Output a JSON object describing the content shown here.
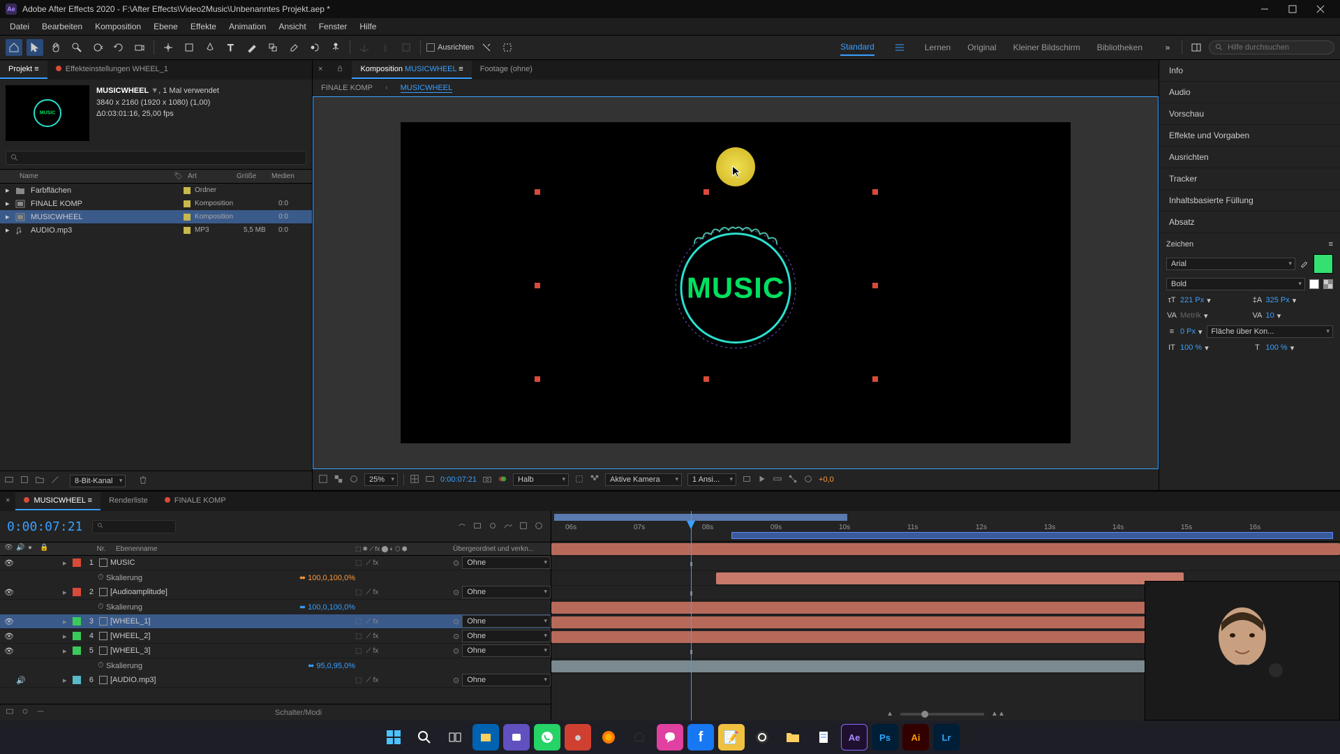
{
  "titlebar": {
    "title": "Adobe After Effects 2020 - F:\\After Effects\\Video2Music\\Unbenanntes Projekt.aep *"
  },
  "menus": [
    "Datei",
    "Bearbeiten",
    "Komposition",
    "Ebene",
    "Effekte",
    "Animation",
    "Ansicht",
    "Fenster",
    "Hilfe"
  ],
  "toolbar": {
    "align": "Ausrichten"
  },
  "workspaces": {
    "items": [
      "Standard",
      "Lernen",
      "Original",
      "Kleiner Bildschirm",
      "Bibliotheken"
    ],
    "activeIndex": 0
  },
  "search": {
    "placeholder": "Hilfe durchsuchen"
  },
  "projectPanel": {
    "tab1": "Projekt",
    "tab2": "Effekteinstellungen  WHEEL_1",
    "compName": "MUSICWHEEL",
    "used": ", 1 Mal verwendet",
    "dims": "3840 x 2160 (1920 x 1080) (1,00)",
    "dur": "Δ0:03:01:16, 25,00 fps",
    "cols": {
      "name": "Name",
      "type": "Art",
      "size": "Größe",
      "media": "Medien"
    },
    "rows": [
      {
        "name": "Farbflächen",
        "type": "Ordner",
        "size": "",
        "media": "",
        "kind": "folder",
        "label": "#c9b84a"
      },
      {
        "name": "FINALE KOMP",
        "type": "Komposition",
        "size": "",
        "media": "0:0",
        "kind": "comp",
        "label": "#c9b84a"
      },
      {
        "name": "MUSICWHEEL",
        "type": "Komposition",
        "size": "",
        "media": "0:0",
        "kind": "comp",
        "label": "#c9b84a",
        "sel": true
      },
      {
        "name": "AUDIO.mp3",
        "type": "MP3",
        "size": "5,5 MB",
        "media": "0:0",
        "kind": "audio",
        "label": "#c9b84a"
      }
    ],
    "footer": "8-Bit-Kanal"
  },
  "compPanel": {
    "tabPrefix": "Komposition",
    "tabComp": "MUSICWHEEL",
    "tabFootage": "Footage  (ohne)",
    "crumb1": "FINALE KOMP",
    "crumb2": "MUSICWHEEL",
    "artText": "MUSIC",
    "footer": {
      "zoom": "25%",
      "time": "0:00:07:21",
      "res": "Halb",
      "camera": "Aktive Kamera",
      "views": "1 Ansi...",
      "exposure": "+0,0"
    }
  },
  "rightPanels": [
    "Info",
    "Audio",
    "Vorschau",
    "Effekte und Vorgaben",
    "Ausrichten",
    "Tracker",
    "Inhaltsbasierte Füllung",
    "Absatz"
  ],
  "charPanel": {
    "title": "Zeichen",
    "font": "Arial",
    "weight": "Bold",
    "color": "#33e070",
    "size": "221 Px",
    "leading": "325 Px",
    "kerning": "Metrik",
    "tracking": "10",
    "stroke": "0 Px",
    "strokeMode": "Fläche über Kon...",
    "vscale": "100 %",
    "hscale": "100 %"
  },
  "timeline": {
    "tab1": "MUSICWHEEL",
    "tab2": "Renderliste",
    "tab3": "FINALE KOMP",
    "time": "0:00:07:21",
    "colNr": "Nr.",
    "colName": "Ebenenname",
    "colParent": "Übergeordnet und verkn...",
    "layers": [
      {
        "nr": "1",
        "name": "MUSIC",
        "kind": "text",
        "label": "#d94a3a",
        "parent": "Ohne"
      },
      {
        "prop": "Skalierung",
        "val": "100,0,100,0%",
        "orange": true
      },
      {
        "nr": "2",
        "name": "[Audioamplitude]",
        "kind": "solid",
        "label": "#d94a3a",
        "parent": "Ohne"
      },
      {
        "prop": "Skalierung",
        "val": "100,0,100,0%"
      },
      {
        "nr": "3",
        "name": "[WHEEL_1]",
        "kind": "comp",
        "label": "#3ac95a",
        "parent": "Ohne",
        "sel": true
      },
      {
        "nr": "4",
        "name": "[WHEEL_2]",
        "kind": "comp",
        "label": "#3ac95a",
        "parent": "Ohne"
      },
      {
        "nr": "5",
        "name": "[WHEEL_3]",
        "kind": "comp",
        "label": "#3ac95a",
        "parent": "Ohne"
      },
      {
        "prop": "Skalierung",
        "val": "95,0,95,0%"
      },
      {
        "nr": "6",
        "name": "[AUDIO.mp3]",
        "kind": "audio",
        "label": "#5ab8c9",
        "parent": "Ohne"
      }
    ],
    "ruler": [
      "06s",
      "07s",
      "08s",
      "09s",
      "10s",
      "11s",
      "12s",
      "13s",
      "14s",
      "15s",
      "16s"
    ],
    "footer": "Schalter/Modi"
  }
}
